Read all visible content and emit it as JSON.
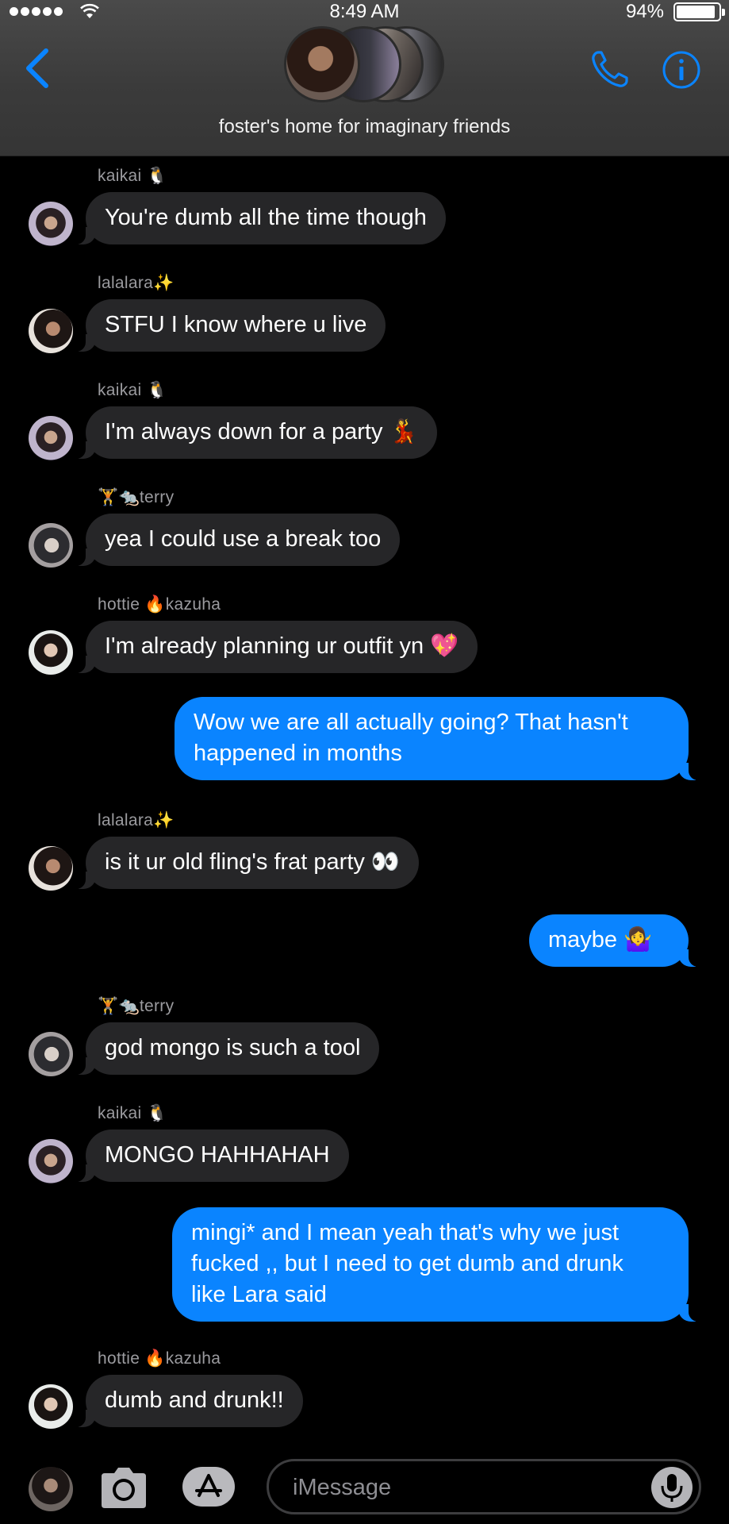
{
  "status_bar": {
    "time": "8:49 AM",
    "battery_percent": "94%",
    "battery_level": 0.94,
    "signal_icon": "signal-dots-icon",
    "wifi_icon": "wifi-icon"
  },
  "header": {
    "group_name": "foster's home for imaginary friends",
    "back_icon": "chevron-left-icon",
    "call_icon": "phone-icon",
    "info_icon": "info-icon",
    "accent_color": "#0a84ff"
  },
  "messages": [
    {
      "sender": "kaikai 🐧",
      "text": "You're dumb all the time though",
      "direction": "incoming"
    },
    {
      "sender": "lalalara✨",
      "text": "STFU I know where u live",
      "direction": "incoming"
    },
    {
      "sender": "kaikai 🐧",
      "text": "I'm always down for a party 💃",
      "direction": "incoming"
    },
    {
      "sender": "🏋🐀terry",
      "text": "yea I could use a break too",
      "direction": "incoming"
    },
    {
      "sender": "hottie 🔥kazuha",
      "text": "I'm already planning ur outfit yn 💖",
      "direction": "incoming"
    },
    {
      "text": "Wow we are all actually going? That hasn't\nhappened in months",
      "direction": "outgoing"
    },
    {
      "sender": "lalalara✨",
      "text": "is it ur old fling's frat party 👀",
      "direction": "incoming"
    },
    {
      "text": "maybe 🤷‍♀️",
      "direction": "outgoing"
    },
    {
      "sender": "🏋🐀terry",
      "text": "god mongo is such a tool",
      "direction": "incoming"
    },
    {
      "sender": "kaikai 🐧",
      "text": "MONGO HAHHAHAH",
      "direction": "incoming"
    },
    {
      "text": "mingi* and I mean yeah that's why we just\nfucked ,, but I need to get dumb and drunk\nlike Lara said",
      "direction": "outgoing"
    },
    {
      "sender": "hottie 🔥kazuha",
      "text": "dumb and drunk!!",
      "direction": "incoming"
    }
  ],
  "input_bar": {
    "placeholder": "iMessage",
    "camera_icon": "camera-icon",
    "apps_icon": "app-store-icon",
    "mic_icon": "microphone-icon"
  },
  "colors": {
    "incoming_bubble": "#262628",
    "outgoing_bubble": "#0a84ff",
    "background": "#000000",
    "header_bg": "#3f3f3f"
  }
}
